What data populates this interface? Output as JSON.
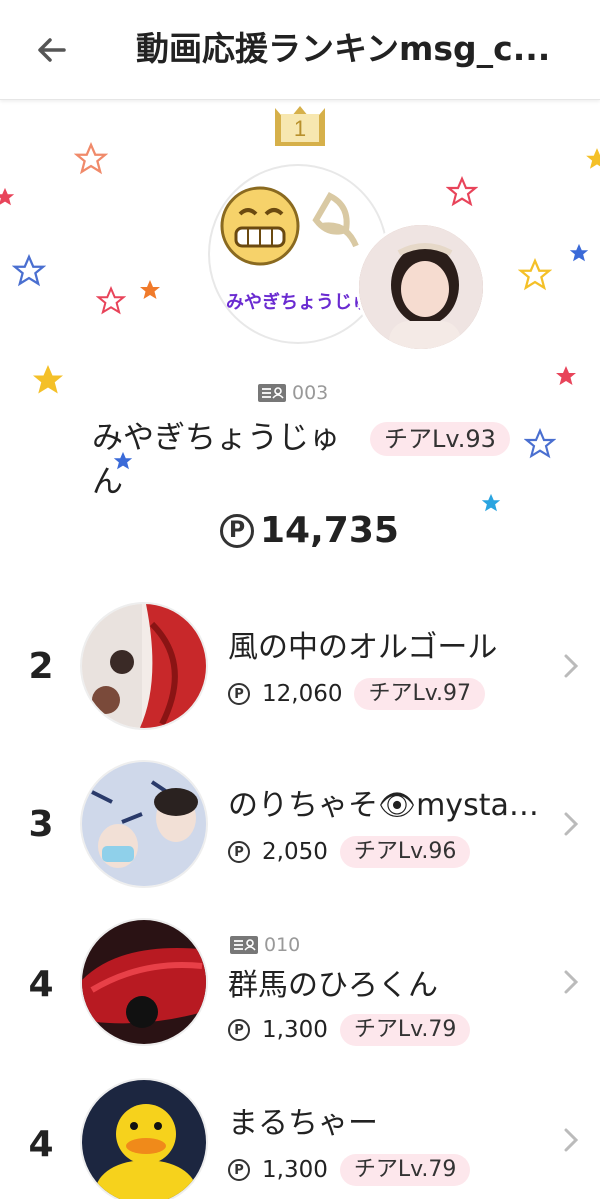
{
  "header": {
    "title": "動画応援ランキンmsg_c...",
    "back_icon": "arrow-left-icon"
  },
  "top": {
    "rank": "1",
    "avatar_caption": "みやぎちょうじゅ",
    "profile_id": "003",
    "name": "みやぎちょうじゅん",
    "level": "チアLv.93",
    "points": "14,735",
    "crown_color": "#d6b04a"
  },
  "ranks": [
    {
      "rank": "2",
      "name": "風の中のオルゴール",
      "points": "12,060",
      "level": "チアLv.97",
      "profile_id": ""
    },
    {
      "rank": "3",
      "name": "のりちゃそ👁mysta隠...",
      "points": "2,050",
      "level": "チアLv.96",
      "profile_id": ""
    },
    {
      "rank": "4",
      "name": "群馬のひろくん",
      "points": "1,300",
      "level": "チアLv.79",
      "profile_id": "010"
    },
    {
      "rank": "4",
      "name": "まるちゃー",
      "points": "1,300",
      "level": "チアLv.79",
      "profile_id": ""
    }
  ],
  "point_symbol": "P",
  "colors": {
    "badge_bg": "#fde7ec",
    "accent_purple": "#6a2bd1"
  }
}
